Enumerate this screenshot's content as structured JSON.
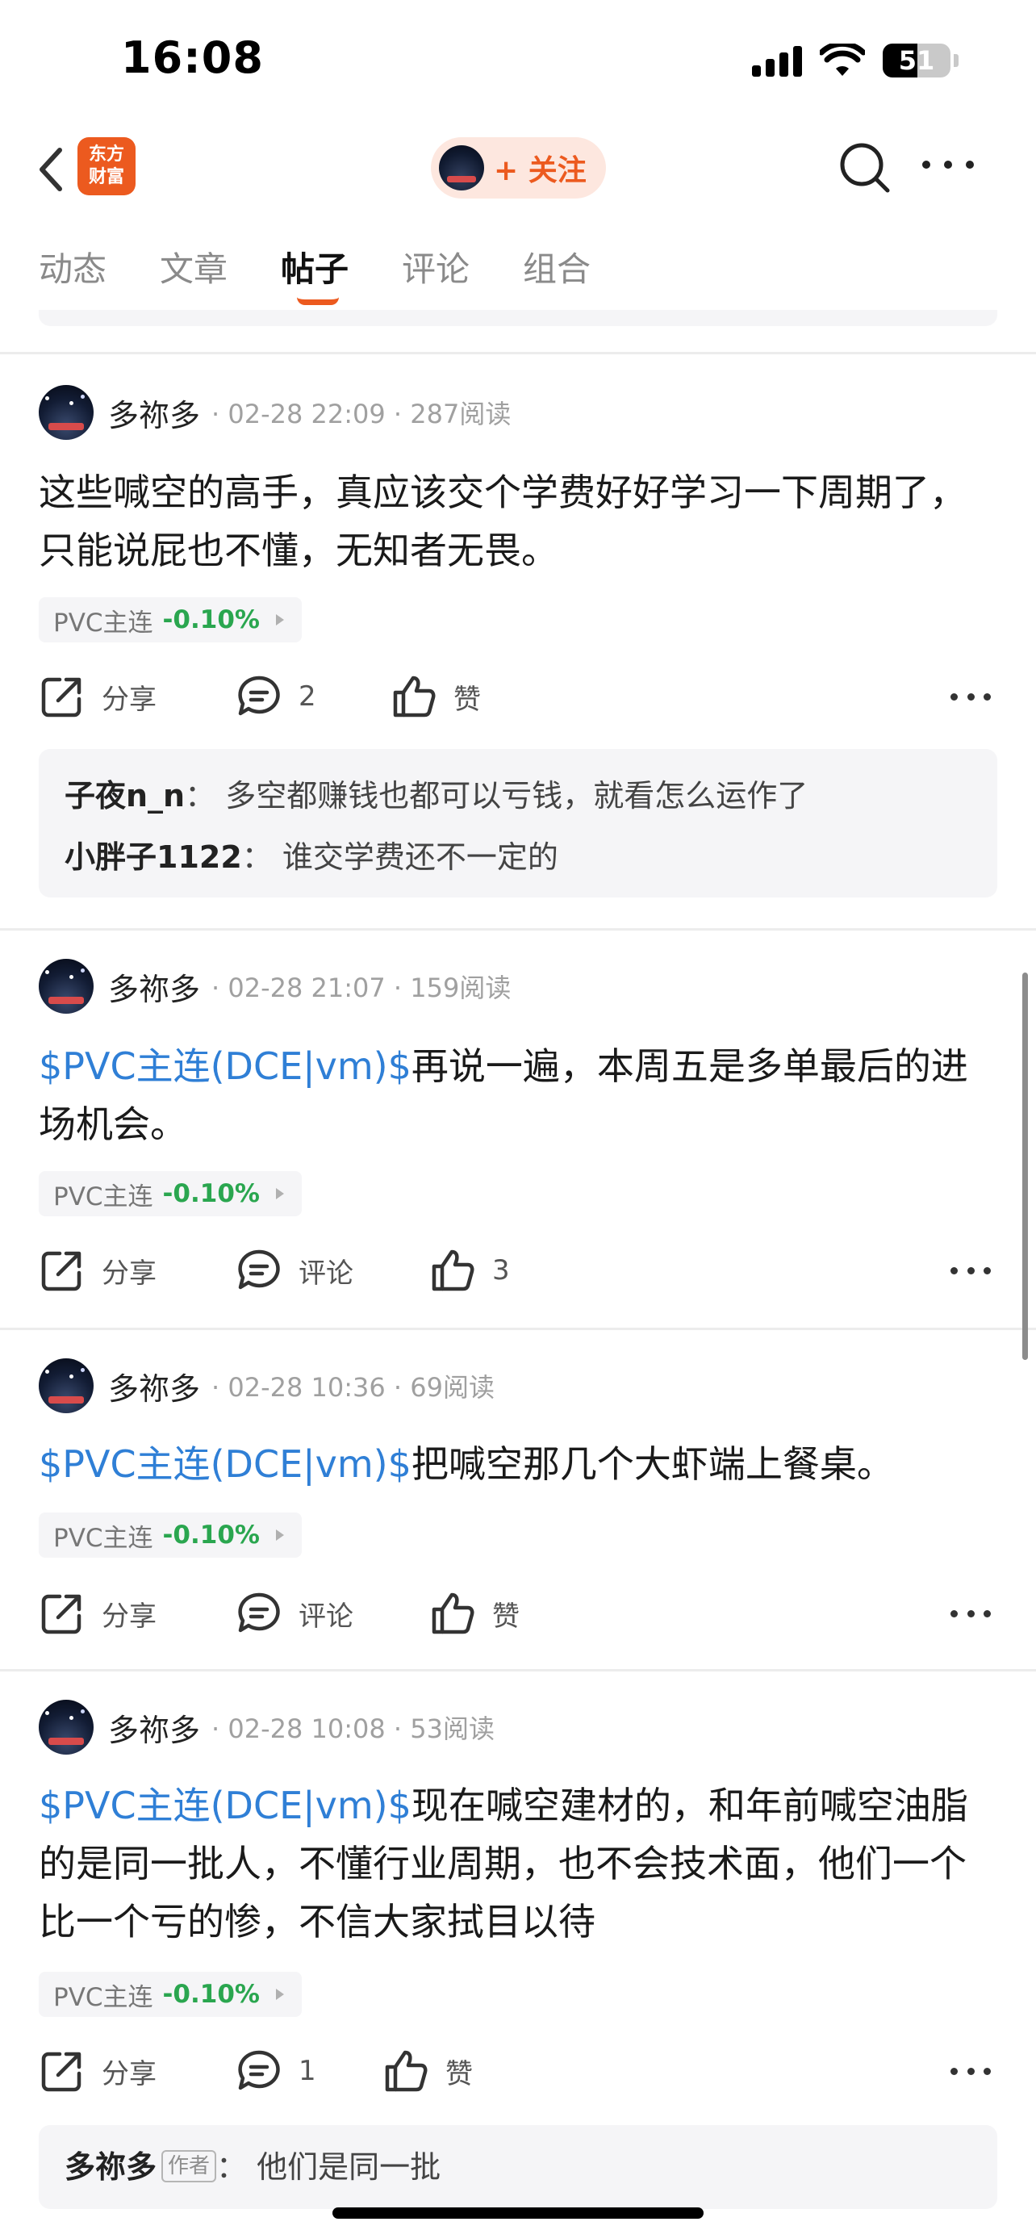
{
  "status_bar": {
    "time": "16:08",
    "battery": "51",
    "battery_level": 0.51,
    "icons": [
      "signal-icon",
      "wifi-icon",
      "battery-icon"
    ]
  },
  "nav": {
    "logo_line1": "东方",
    "logo_line2": "财富",
    "follow_label": "+ 关注",
    "icons": [
      "back-icon",
      "search-icon",
      "more-icon"
    ]
  },
  "tabs": [
    {
      "label": "动态",
      "active": false
    },
    {
      "label": "文章",
      "active": false
    },
    {
      "label": "帖子",
      "active": true
    },
    {
      "label": "评论",
      "active": false
    },
    {
      "label": "组合",
      "active": false
    }
  ],
  "colors": {
    "accent": "#ec5a1f",
    "link": "#2f7fd6",
    "down": "#2aa64f",
    "muted": "#a0a0a0"
  },
  "posts": [
    {
      "author": "多祢多",
      "meta": "· 02-28 22:09 · 287阅读",
      "stock_ref": "",
      "body": "这些喊空的高手，真应该交个学费好好学习一下周期了，只能说屁也不懂，无知者无畏。",
      "tag_name": "PVC主连",
      "tag_change": "-0.10%",
      "share": "分享",
      "comment": "2",
      "like": "赞",
      "replies": [
        {
          "name": "子夜n_n",
          "sep": "：",
          "text": "多空都赚钱也都可以亏钱，就看怎么运作了"
        },
        {
          "name": "小胖子1122",
          "sep": "：",
          "text": "谁交学费还不一定的"
        }
      ]
    },
    {
      "author": "多祢多",
      "meta": "· 02-28 21:07 · 159阅读",
      "stock_ref": "$PVC主连(DCE|vm)$",
      "body": "再说一遍，本周五是多单最后的进场机会。",
      "tag_name": "PVC主连",
      "tag_change": "-0.10%",
      "share": "分享",
      "comment": "评论",
      "like": "3"
    },
    {
      "author": "多祢多",
      "meta": "· 02-28 10:36 · 69阅读",
      "stock_ref": "$PVC主连(DCE|vm)$",
      "body": "把喊空那几个大虾端上餐桌。",
      "tag_name": "PVC主连",
      "tag_change": "-0.10%",
      "share": "分享",
      "comment": "评论",
      "like": "赞"
    },
    {
      "author": "多祢多",
      "meta": "· 02-28 10:08 · 53阅读",
      "stock_ref": "$PVC主连(DCE|vm)$",
      "body": "现在喊空建材的，和年前喊空油脂的是同一批人，不懂行业周期，也不会技术面，他们一个比一个亏的惨，不信大家拭目以待",
      "tag_name": "PVC主连",
      "tag_change": "-0.10%",
      "share": "分享",
      "comment": "1",
      "like": "赞",
      "replies": [
        {
          "name": "多祢多",
          "badge": "作者",
          "sep": "：",
          "text": "他们是同一批"
        }
      ]
    }
  ]
}
